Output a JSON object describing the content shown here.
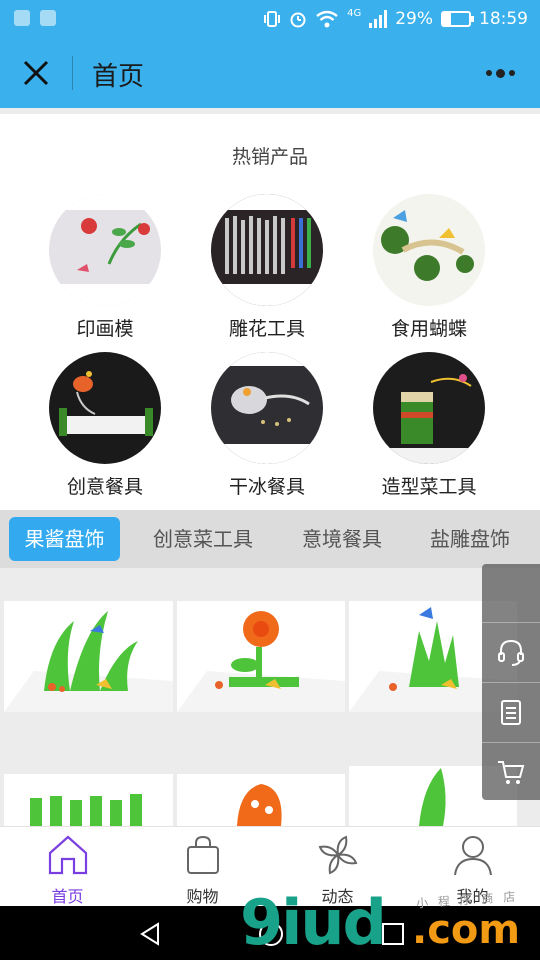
{
  "status_bar": {
    "network": "4G",
    "battery_percent": "29%",
    "battery_level": 0.29,
    "time": "18:59",
    "icons": [
      "app-notification-icon",
      "gallery-notification-icon",
      "vibrate-icon",
      "alarm-icon",
      "wifi-icon",
      "signal-icon",
      "battery-icon"
    ]
  },
  "nav": {
    "title": "首页",
    "close_icon": "close-icon",
    "more_icon": "more-icon"
  },
  "hot": {
    "title": "热销产品",
    "products": [
      {
        "label": "印画模",
        "icon": "stamp-mold-image"
      },
      {
        "label": "雕花工具",
        "icon": "carving-tools-image"
      },
      {
        "label": "食用蝴蝶",
        "icon": "edible-butterfly-image"
      },
      {
        "label": "创意餐具",
        "icon": "creative-tableware-image"
      },
      {
        "label": "干冰餐具",
        "icon": "dry-ice-tableware-image"
      },
      {
        "label": "造型菜工具",
        "icon": "shaped-dish-tool-image"
      }
    ]
  },
  "tabs": [
    {
      "label": "果酱盘饰",
      "active": true
    },
    {
      "label": "创意菜工具",
      "active": false
    },
    {
      "label": "意境餐具",
      "active": false
    },
    {
      "label": "盐雕盘饰",
      "active": false
    }
  ],
  "side_menu": {
    "items": [
      "headset-icon",
      "clipboard-icon",
      "cart-icon"
    ]
  },
  "bottom_tabs": [
    {
      "label": "首页",
      "icon": "home-icon",
      "active": true
    },
    {
      "label": "购物",
      "icon": "shopping-bag-icon",
      "active": false
    },
    {
      "label": "动态",
      "icon": "pinwheel-icon",
      "active": false
    },
    {
      "label": "我的",
      "icon": "user-icon",
      "active": false
    }
  ],
  "watermark": {
    "main": "9iud",
    "suffix": ".com",
    "small": "小 程 序 商 店"
  },
  "colors": {
    "header": "#3ab0ec",
    "active_tab": "#33aaf0",
    "active_bottom": "#7a3fe0",
    "watermark_green": "#19a28a",
    "watermark_orange": "#f39a14"
  }
}
